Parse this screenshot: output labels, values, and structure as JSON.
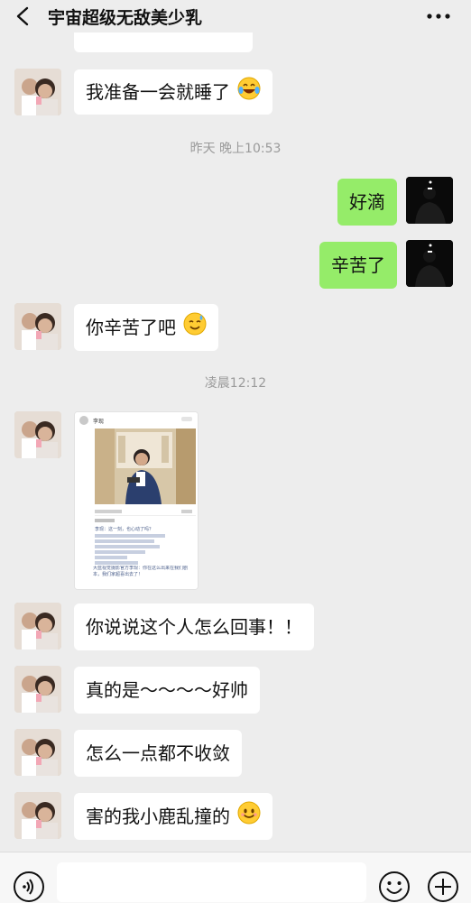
{
  "header": {
    "title": "宇宙超级无敌美少乳"
  },
  "messages": [
    {
      "text": "我准备一会就睡了"
    },
    {
      "text": "好滴"
    },
    {
      "text": "辛苦了"
    },
    {
      "text": "你辛苦了吧"
    },
    {
      "text": "你说说这个人怎么回事！！"
    },
    {
      "text": "真的是～～～～好帅"
    },
    {
      "text": "怎么一点都不收敛"
    },
    {
      "text": "害的我小鹿乱撞的"
    }
  ],
  "timestamps": [
    "昨天 晚上10:53",
    "凌晨12:12"
  ],
  "shared_image": {
    "author": "李现",
    "caption_1": "李现：这一刻，也心动了吗？",
    "caption_2": "大蓝视觉摄影官方李现：你在这么出来在我们剧本，我们家超喜出去了！"
  },
  "input": {
    "placeholder": ""
  },
  "icons": {
    "back": "chevron-left-icon",
    "more": "more-dots-icon",
    "voice": "voice-icon",
    "emoji": "emoji-icon",
    "plus": "plus-icon"
  }
}
